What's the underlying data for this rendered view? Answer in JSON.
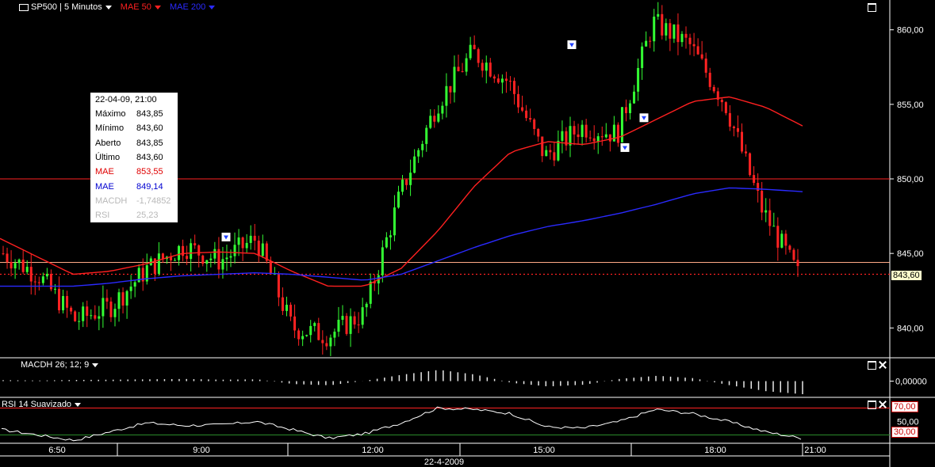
{
  "header": {
    "symbol": "SP500",
    "interval": "5 Minutos",
    "mae50_label": "MAE 50",
    "mae200_label": "MAE 200",
    "mae50_color": "#ff2020",
    "mae200_color": "#2a2aff"
  },
  "infobox": {
    "datetime": "22-04-09, 21:00",
    "rows": [
      {
        "k": "Máximo",
        "v": "843,85",
        "color": "#000000"
      },
      {
        "k": "Mínimo",
        "v": "843,60",
        "color": "#000000"
      },
      {
        "k": "Aberto",
        "v": "843,85",
        "color": "#000000"
      },
      {
        "k": "Último",
        "v": "843,60",
        "color": "#000000"
      },
      {
        "k": "MAE",
        "v": "853,55",
        "color": "#e00000"
      },
      {
        "k": "MAE",
        "v": "849,14",
        "color": "#0000d0"
      },
      {
        "k": "MACDH",
        "v": "-1,74852",
        "color": "#b8b8b8"
      },
      {
        "k": "RSI",
        "v": "25,23",
        "color": "#b8b8b8"
      }
    ]
  },
  "price_axis": {
    "ticks": [
      "860,00",
      "855,00",
      "850,00",
      "845,00",
      "840,00"
    ],
    "last_price_label": "843,60"
  },
  "macd_panel": {
    "label": "MACDH 26; 12; 9",
    "axis_tick": "0,00000"
  },
  "rsi_panel": {
    "label": "RSI 14 Suavizado",
    "upper_label": "70,00",
    "mid_tick": "50,00",
    "lower_label": "30,00"
  },
  "time_axis": {
    "ticks": [
      "6:50",
      "9:00",
      "12:00",
      "15:00",
      "18:00",
      "21:00"
    ],
    "date": "22-4-2009"
  },
  "colors": {
    "up": "#33ff33",
    "down": "#ff2222",
    "mae50": "#ff2020",
    "mae200": "#2a2aff",
    "hline": "#ff2222",
    "hline2": "#ffaa88",
    "rsi": "#ffffff",
    "macd": "#e8e8e8"
  },
  "chart_data": {
    "type": "candlestick",
    "ylim": [
      838,
      862
    ],
    "x": [
      "6:50",
      "7:30",
      "8:10",
      "8:50",
      "9:30",
      "10:10",
      "10:50",
      "11:30",
      "12:10",
      "12:50",
      "13:30",
      "14:10",
      "14:50",
      "15:30",
      "16:10",
      "16:50",
      "17:30",
      "18:10",
      "18:50",
      "19:30",
      "20:10",
      "20:50",
      "21:00"
    ],
    "close": [
      845.0,
      843.5,
      840.5,
      841.5,
      844.0,
      845.5,
      844.5,
      846.0,
      840.0,
      839.5,
      841.0,
      849.0,
      855.0,
      858.5,
      856.5,
      851.5,
      853.5,
      853.0,
      860.5,
      859.0,
      855.0,
      848.0,
      843.6
    ],
    "mae50": [
      846.0,
      844.8,
      843.6,
      843.8,
      844.3,
      845.0,
      845.1,
      845.0,
      843.8,
      842.8,
      842.8,
      844.0,
      846.5,
      849.5,
      851.8,
      852.5,
      852.3,
      852.8,
      854.0,
      855.2,
      855.5,
      854.8,
      853.55
    ],
    "mae200": [
      842.8,
      842.8,
      842.8,
      843.0,
      843.3,
      843.5,
      843.6,
      843.7,
      843.6,
      843.4,
      843.2,
      843.6,
      844.5,
      845.4,
      846.2,
      846.8,
      847.2,
      847.7,
      848.3,
      849.0,
      849.4,
      849.3,
      849.14
    ],
    "horizontal_levels": [
      850.0,
      844.4
    ],
    "last_price": 843.6,
    "macdh_ylim": [
      -1,
      1
    ],
    "macdh": [
      0.08,
      0.05,
      0.1,
      0.12,
      0.15,
      0.18,
      0.12,
      0.15,
      -0.25,
      -0.35,
      0.05,
      0.55,
      0.95,
      0.55,
      -0.15,
      -0.45,
      -0.3,
      0.2,
      0.45,
      0.25,
      -0.35,
      -0.85,
      -1.1
    ],
    "rsi": [
      38,
      30,
      22,
      35,
      48,
      44,
      45,
      50,
      38,
      25,
      32,
      48,
      70,
      68,
      62,
      42,
      40,
      50,
      68,
      62,
      50,
      35,
      25.23
    ],
    "rsi_levels": [
      70,
      30
    ]
  }
}
